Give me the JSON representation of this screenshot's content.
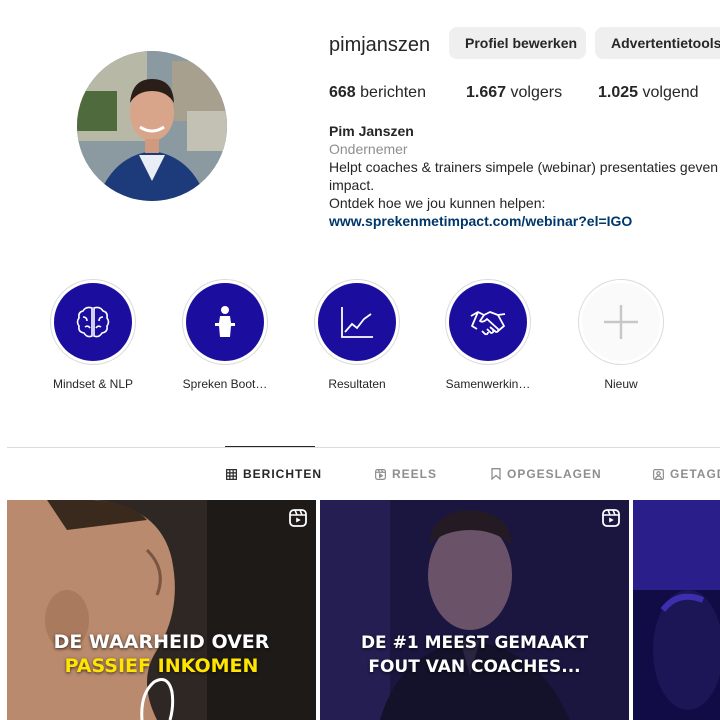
{
  "profile": {
    "username": "pimjanszen",
    "edit_button": "Profiel bewerken",
    "ads_button": "Advertentietools",
    "stats": {
      "posts_count": "668",
      "posts_label": "berichten",
      "followers_count": "1.667",
      "followers_label": "volgers",
      "following_count": "1.025",
      "following_label": "volgend"
    },
    "bio": {
      "name": "Pim Janszen",
      "category": "Ondernemer",
      "line1": "Helpt coaches & trainers simpele (webinar) presentaties geven vol",
      "line2": "impact.",
      "line3": "Ontdek hoe we jou kunnen helpen:",
      "link": "www.sprekenmetimpact.com/webinar?el=IGO"
    }
  },
  "highlights": [
    {
      "label": "Mindset & NLP",
      "icon": "brain-icon"
    },
    {
      "label": "Spreken Boot…",
      "icon": "podium-speaker-icon"
    },
    {
      "label": "Resultaten",
      "icon": "growth-chart-icon"
    },
    {
      "label": "Samenwerkin…",
      "icon": "handshake-icon"
    },
    {
      "label": "Nieuw",
      "icon": "plus-icon"
    }
  ],
  "tabs": [
    {
      "label": "BERICHTEN",
      "icon": "grid-icon",
      "active": true
    },
    {
      "label": "REELS",
      "icon": "reels-icon",
      "active": false
    },
    {
      "label": "OPGESLAGEN",
      "icon": "bookmark-icon",
      "active": false
    },
    {
      "label": "GETAGD",
      "icon": "tagged-icon",
      "active": false
    }
  ],
  "posts": [
    {
      "caption_line1": "DE WAARHEID OVER",
      "caption_line2": "PASSIEF INKOMEN",
      "type": "reel"
    },
    {
      "caption_line1": "DE #1 MEEST GEMAAKT",
      "caption_line2": "FOUT VAN COACHES...",
      "type": "reel"
    },
    {
      "type": "reel"
    }
  ],
  "colors": {
    "highlight_bg": "#1b0e9e",
    "link": "#00376b",
    "caption_yellow": "#ffe500",
    "button_bg": "#efefef"
  }
}
